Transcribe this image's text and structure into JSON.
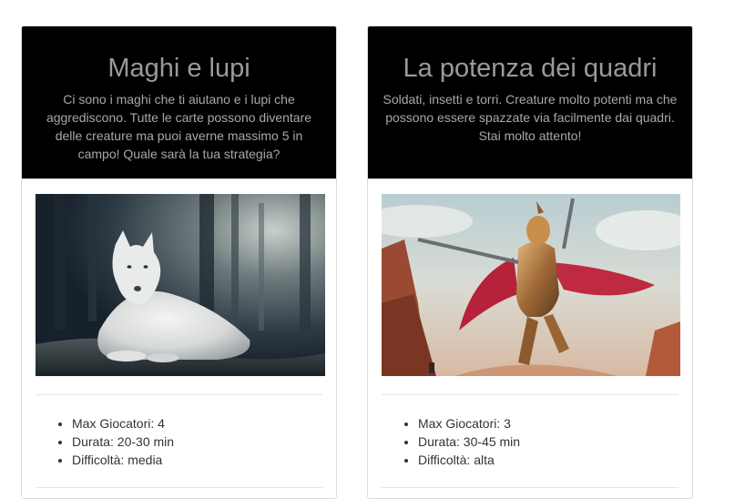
{
  "cards": [
    {
      "title": "Maghi e lupi",
      "description": "Ci sono i maghi che ti aiutano e i lupi che aggrediscono. Tutte le carte possono diventare delle creature ma puoi averne massimo 5 in campo! Quale sarà la tua strategia?",
      "image": "white-wolf-in-misty-forest",
      "details": [
        "Max Giocatori: 4",
        "Durata: 20-30 min",
        "Difficoltà: media"
      ]
    },
    {
      "title": "La potenza dei quadri",
      "description": "Soldati, insetti e torri. Creature molto potenti ma che possono essere spazzate via facilmente dai quadri. Stai molto attento!",
      "image": "armored-warrior-with-sword",
      "details": [
        "Max Giocatori: 3",
        "Durata: 30-45 min",
        "Difficoltà: alta"
      ]
    }
  ]
}
